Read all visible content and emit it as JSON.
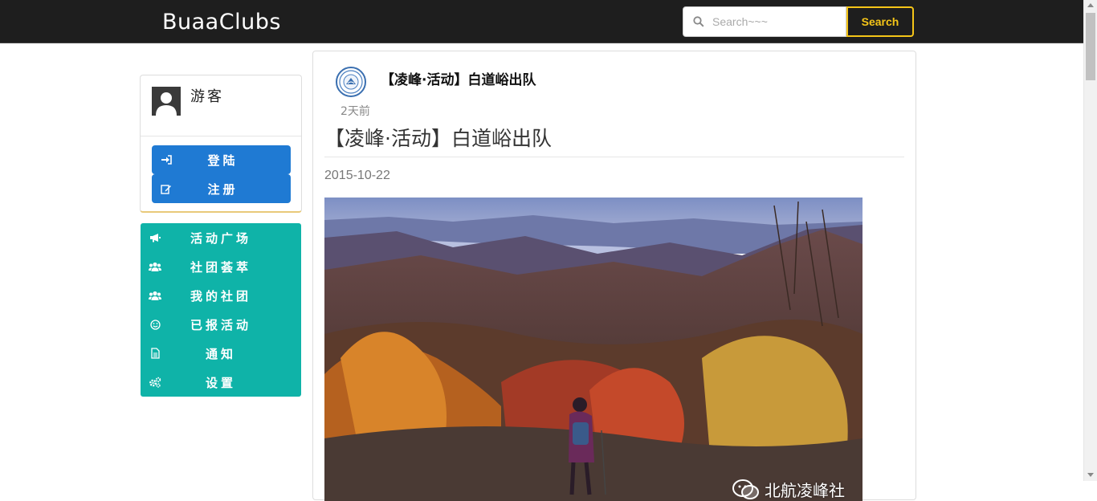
{
  "header": {
    "brand": "BuaaClubs",
    "search_placeholder": "Search~~~",
    "search_button": "Search"
  },
  "user": {
    "name": "游客",
    "login_label": "登陆",
    "register_label": "注册"
  },
  "nav": {
    "items": [
      {
        "label": "活动广场",
        "icon": "bullhorn-icon"
      },
      {
        "label": "社团荟萃",
        "icon": "users-icon"
      },
      {
        "label": "我的社团",
        "icon": "users-icon"
      },
      {
        "label": "已报活动",
        "icon": "smile-icon"
      },
      {
        "label": "通知",
        "icon": "file-icon"
      },
      {
        "label": "设置",
        "icon": "gears-icon"
      }
    ]
  },
  "post": {
    "club_name": "【凌峰·活动】白道峪出队",
    "time_ago": "2天前",
    "title": "【凌峰·活动】白道峪出队",
    "date": "2015-10-22",
    "image_watermark": "北航凌峰社"
  },
  "colors": {
    "topbar": "#1e1e1e",
    "accent_yellow": "#f5c518",
    "auth_blue": "#1f7ad3",
    "nav_teal": "#0fb3a8"
  }
}
